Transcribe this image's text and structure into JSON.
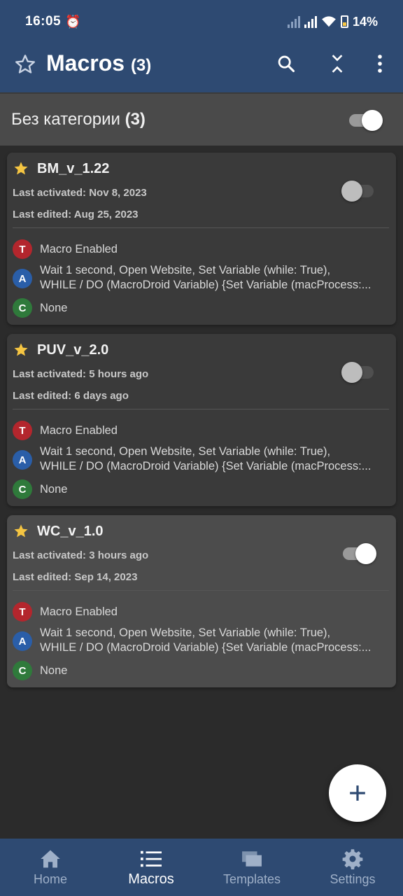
{
  "status_bar": {
    "time": "16:05",
    "battery_percent": "14%",
    "icons": [
      "alarm-icon",
      "signal-icon",
      "wifi-icon",
      "battery-icon"
    ]
  },
  "app_bar": {
    "title": "Macros",
    "count": "(3)",
    "icons": [
      "star-icon",
      "search-icon",
      "collapse-icon",
      "more-vert-icon"
    ]
  },
  "category": {
    "name": "Без категории",
    "count": "(3)",
    "enabled": true
  },
  "macros": [
    {
      "name": "BM_v_1.22",
      "last_activated": "Last activated: Nov 8, 2023",
      "last_edited": "Last edited: Aug 25, 2023",
      "enabled": false,
      "trigger_badge": "T",
      "trigger": "Macro Enabled",
      "action_badge": "A",
      "actions_line1": "Wait 1 second, Open Website, Set Variable (while: True),",
      "actions_line2": "WHILE / DO (MacroDroid Variable) {Set Variable (macProcess:...",
      "constraint_badge": "C",
      "constraint": "None"
    },
    {
      "name": "PUV_v_2.0",
      "last_activated": "Last activated: 5 hours ago",
      "last_edited": "Last edited: 6 days ago",
      "enabled": false,
      "trigger_badge": "T",
      "trigger": "Macro Enabled",
      "action_badge": "A",
      "actions_line1": "Wait 1 second, Open Website, Set Variable (while: True),",
      "actions_line2": "WHILE / DO (MacroDroid Variable) {Set Variable (macProcess:...",
      "constraint_badge": "C",
      "constraint": "None"
    },
    {
      "name": "WC_v_1.0",
      "last_activated": "Last activated: 3 hours ago",
      "last_edited": "Last edited: Sep 14, 2023",
      "enabled": true,
      "trigger_badge": "T",
      "trigger": "Macro Enabled",
      "action_badge": "A",
      "actions_line1": "Wait 1 second, Open Website, Set Variable (while: True),",
      "actions_line2": "WHILE / DO (MacroDroid Variable) {Set Variable (macProcess:...",
      "constraint_badge": "C",
      "constraint": "None"
    }
  ],
  "fab": {
    "icon": "plus-icon",
    "label": "+"
  },
  "bottom_nav": {
    "selected": "Macros",
    "items": [
      {
        "label": "Home",
        "icon": "home-icon"
      },
      {
        "label": "Macros",
        "icon": "list-icon"
      },
      {
        "label": "Templates",
        "icon": "templates-icon"
      },
      {
        "label": "Settings",
        "icon": "gear-icon"
      }
    ]
  },
  "colors": {
    "app_bar": "#2e4a72",
    "background": "#2b2b2b",
    "card": "#3a3a3a",
    "card_active": "#4c4c4c",
    "star": "#f5c542",
    "trigger_badge": "#b3262d",
    "action_badge": "#2a5ea8",
    "constraint_badge": "#2f7a3b"
  }
}
